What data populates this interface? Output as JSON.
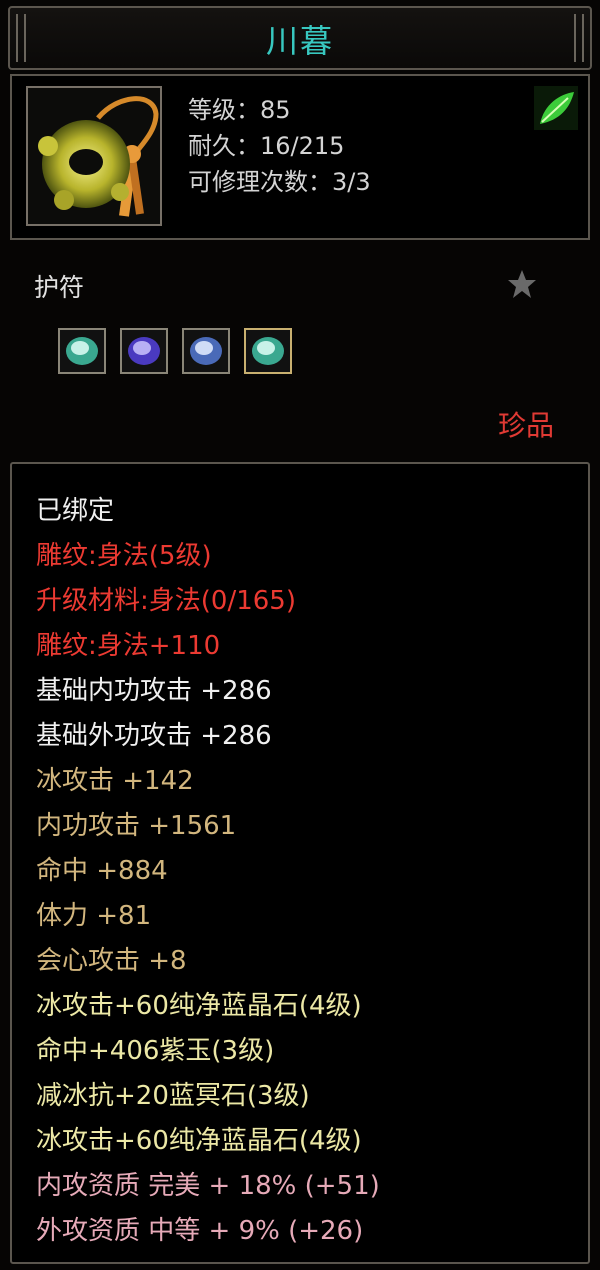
{
  "title": "川暮",
  "header": {
    "level": "等级：85",
    "durability": "耐久：16/215",
    "repairs": "可修理次数：3/3"
  },
  "category": "护符",
  "gems": [
    "jade-gem-icon",
    "purple-gem-icon",
    "blue-gem-icon",
    "jade-gem-icon"
  ],
  "rarity": "珍品",
  "attributes": [
    {
      "text": "已绑定",
      "color": "white"
    },
    {
      "text": "雕纹:身法(5级)",
      "color": "red"
    },
    {
      "text": "升级材料:身法(0/165)",
      "color": "red"
    },
    {
      "text": "雕纹:身法+110",
      "color": "red"
    },
    {
      "text": "基础内功攻击 +286",
      "color": "white"
    },
    {
      "text": "基础外功攻击 +286",
      "color": "white"
    },
    {
      "text": "冰攻击 +142",
      "color": "tan"
    },
    {
      "text": "内功攻击 +1561",
      "color": "tan"
    },
    {
      "text": "命中 +884",
      "color": "tan"
    },
    {
      "text": "体力 +81",
      "color": "tan"
    },
    {
      "text": "会心攻击 +8",
      "color": "tan"
    },
    {
      "text": "冰攻击+60纯净蓝晶石(4级)",
      "color": "yellow"
    },
    {
      "text": "命中+406紫玉(3级)",
      "color": "yellow"
    },
    {
      "text": "减冰抗+20蓝冥石(3级)",
      "color": "yellow"
    },
    {
      "text": "冰攻击+60纯净蓝晶石(4级)",
      "color": "yellow"
    },
    {
      "text": "内攻资质 完美 + 18% (+51)",
      "color": "pink"
    },
    {
      "text": "外攻资质 中等 + 9% (+26)",
      "color": "pink"
    }
  ]
}
